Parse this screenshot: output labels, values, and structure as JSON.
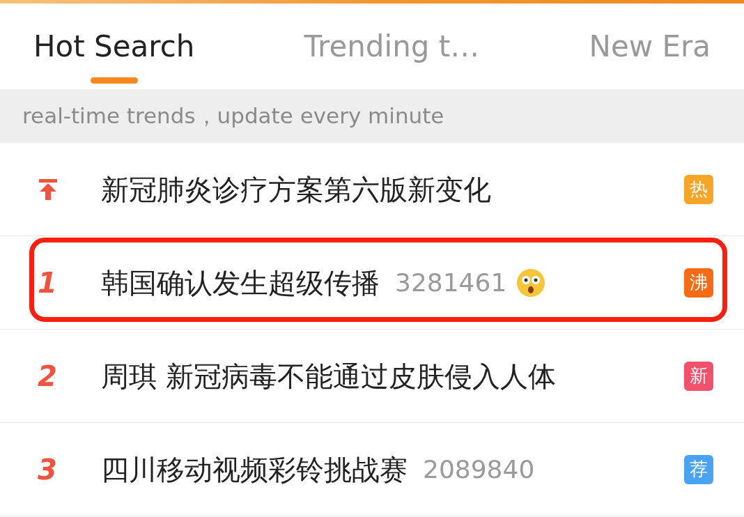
{
  "tabs": [
    {
      "label": "Hot Search",
      "selected": true
    },
    {
      "label": "Trending t…",
      "selected": false
    },
    {
      "label": "New Era",
      "selected": false
    }
  ],
  "notice": "real-time trends，update every minute",
  "rows": [
    {
      "kind": "pinned",
      "title": "新冠肺炎诊疗方案第六版新变化",
      "highlighted": false,
      "badge": {
        "text": "热",
        "color": "#f8a427"
      }
    },
    {
      "kind": "ranked",
      "rank": "1",
      "title": "韩国确认发生超级传播",
      "count": "3281461",
      "emoji": true,
      "highlighted": true,
      "badge": {
        "text": "沸",
        "color": "#f56b16"
      }
    },
    {
      "kind": "ranked",
      "rank": "2",
      "title": "周琪 新冠病毒不能通过皮肤侵入人体",
      "highlighted": false,
      "badge": {
        "text": "新",
        "color": "#f2516b"
      }
    },
    {
      "kind": "ranked",
      "rank": "3",
      "title": "四川移动视频彩铃挑战赛",
      "count": "2089840",
      "highlighted": false,
      "badge": {
        "text": "荐",
        "color": "#4aa3f2"
      }
    }
  ]
}
